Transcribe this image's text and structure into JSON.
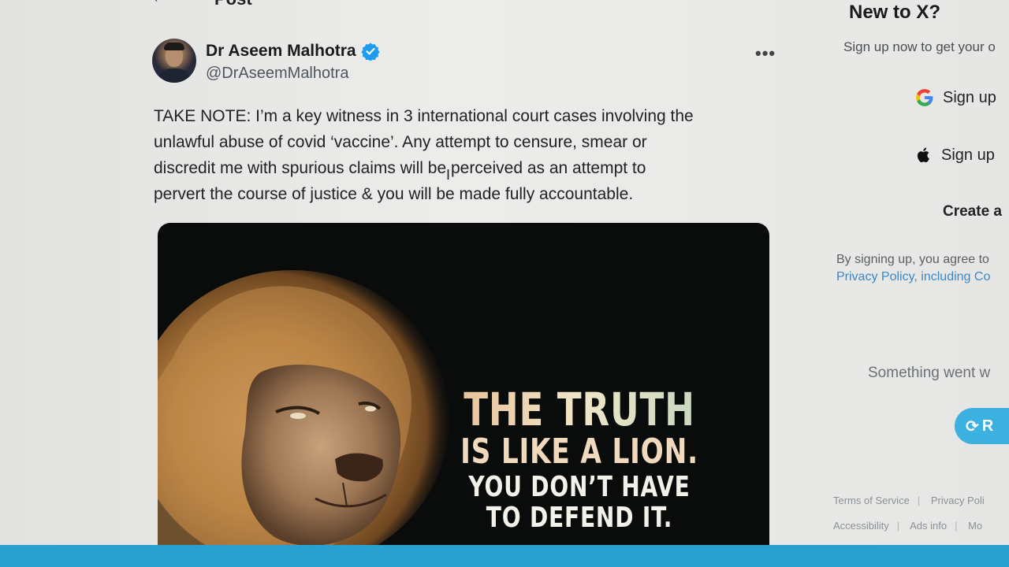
{
  "header": {
    "title": "Post"
  },
  "post": {
    "author_name": "Dr Aseem Malhotra",
    "author_handle": "@DrAseemMalhotra",
    "more_label": "•••",
    "body_lines": [
      "TAKE NOTE: I’m a key witness in 3 international court cases involving the",
      "unlawful abuse of covid ‘vaccine’. Any attempt to censure, smear or",
      "discredit me with spurious claims will be perceived as an attempt to",
      "pervert the course of justice & you will be made fully accountable."
    ],
    "image_quote": {
      "line1": "THE TRUTH",
      "line2": "IS LIKE A LION.",
      "line3": "YOU DON’T HAVE",
      "line4": "TO DEFEND IT."
    }
  },
  "sidebar": {
    "title": "New to X?",
    "subtitle": "Sign up now to get your o",
    "google_button": "Sign up",
    "apple_button": "Sign up",
    "create_account": "Create a",
    "terms_line1": "By signing up, you agree to",
    "terms_line2": "Privacy Policy, including Co",
    "error_text": "Something went w",
    "retry_label": "R",
    "footer": {
      "terms": "Terms of Service",
      "privacy": "Privacy Poli",
      "accessibility": "Accessibility",
      "ads": "Ads info",
      "more": "Mo"
    }
  },
  "colors": {
    "accent": "#1d9bf0",
    "banner": "#2aa0cf",
    "link": "#3a87c9"
  }
}
